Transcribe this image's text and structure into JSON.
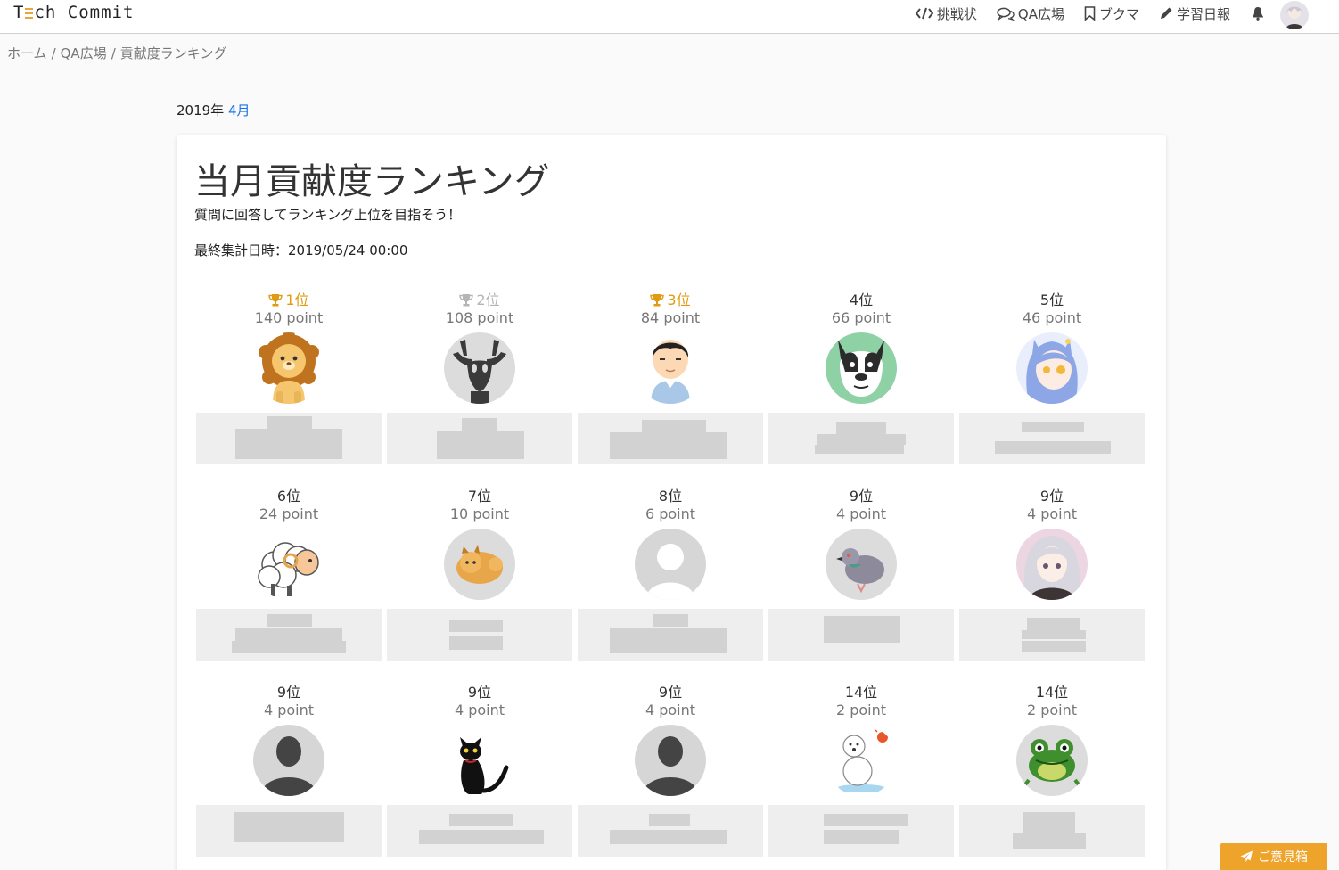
{
  "header": {
    "logo_first": "T",
    "logo_rest": "ch Commit",
    "nav": [
      {
        "label": "挑戦状",
        "icon": "code-icon"
      },
      {
        "label": "QA広場",
        "icon": "comments-icon"
      },
      {
        "label": "ブクマ",
        "icon": "bookmark-icon"
      },
      {
        "label": "学習日報",
        "icon": "pencil-icon"
      }
    ],
    "bell_icon": "bell-icon",
    "avatar_icon": "user-avatar"
  },
  "breadcrumb": [
    "ホーム",
    "QA広場",
    "貢献度ランキング"
  ],
  "breadcrumb_sep": "/",
  "period": {
    "year": "2019年",
    "month": "4月"
  },
  "card": {
    "title": "当月貢献度ランキング",
    "subtitle": "質問に回答してランキング上位を目指そう！",
    "updated": "最終集計日時：2019/05/24 00:00"
  },
  "ranking": [
    {
      "rank": "1位",
      "points": "140 point",
      "medal": "gold",
      "avatar": "lion"
    },
    {
      "rank": "2位",
      "points": "108 point",
      "medal": "silver",
      "avatar": "deer"
    },
    {
      "rank": "3位",
      "points": "84 point",
      "medal": "bronze",
      "avatar": "boy"
    },
    {
      "rank": "4位",
      "points": "66 point",
      "medal": "",
      "avatar": "bulldog"
    },
    {
      "rank": "5位",
      "points": "46 point",
      "medal": "",
      "avatar": "anime-blue"
    },
    {
      "rank": "6位",
      "points": "24 point",
      "medal": "",
      "avatar": "sheep"
    },
    {
      "rank": "7位",
      "points": "10 point",
      "medal": "",
      "avatar": "pomeranian"
    },
    {
      "rank": "8位",
      "points": "6 point",
      "medal": "",
      "avatar": "default-light"
    },
    {
      "rank": "9位",
      "points": "4 point",
      "medal": "",
      "avatar": "pigeon"
    },
    {
      "rank": "9位",
      "points": "4 point",
      "medal": "",
      "avatar": "anime-silver"
    },
    {
      "rank": "9位",
      "points": "4 point",
      "medal": "",
      "avatar": "default-dark"
    },
    {
      "rank": "9位",
      "points": "4 point",
      "medal": "",
      "avatar": "black-cat"
    },
    {
      "rank": "9位",
      "points": "4 point",
      "medal": "",
      "avatar": "default-dark"
    },
    {
      "rank": "14位",
      "points": "2 point",
      "medal": "",
      "avatar": "polar-bear"
    },
    {
      "rank": "14位",
      "points": "2 point",
      "medal": "",
      "avatar": "frog"
    }
  ],
  "feedback_label": "ご意見箱",
  "colors": {
    "accent": "#eea32a",
    "gold": "#e09b12",
    "silver": "#b5b5b5",
    "link": "#1a73e8"
  }
}
